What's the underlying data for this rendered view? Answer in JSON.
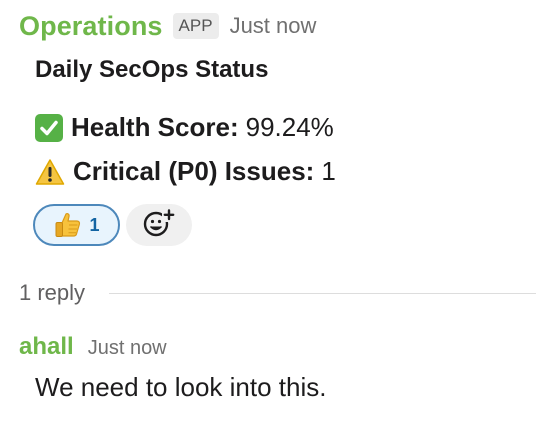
{
  "message": {
    "sender": "Operations",
    "badge": "APP",
    "timestamp": "Just now",
    "title": "Daily SecOps Status",
    "lines": [
      {
        "icon": "check-mark-icon",
        "label": "Health Score:",
        "value": "99.24%"
      },
      {
        "icon": "warning-icon",
        "label": "Critical (P0) Issues:",
        "value": "1"
      }
    ],
    "reactions": [
      {
        "icon": "thumbs-up-icon",
        "count": "1"
      }
    ],
    "add_reaction_icon": "add-reaction-icon"
  },
  "thread": {
    "reply_count": "1 reply"
  },
  "reply": {
    "user": "ahall",
    "timestamp": "Just now",
    "text": "We need to look into this."
  },
  "colors": {
    "sender": "#6fb74a",
    "reaction_border": "#4d88bb",
    "reaction_count": "#1264a3",
    "check_bg": "#56b146",
    "warning": "#f5c542"
  }
}
